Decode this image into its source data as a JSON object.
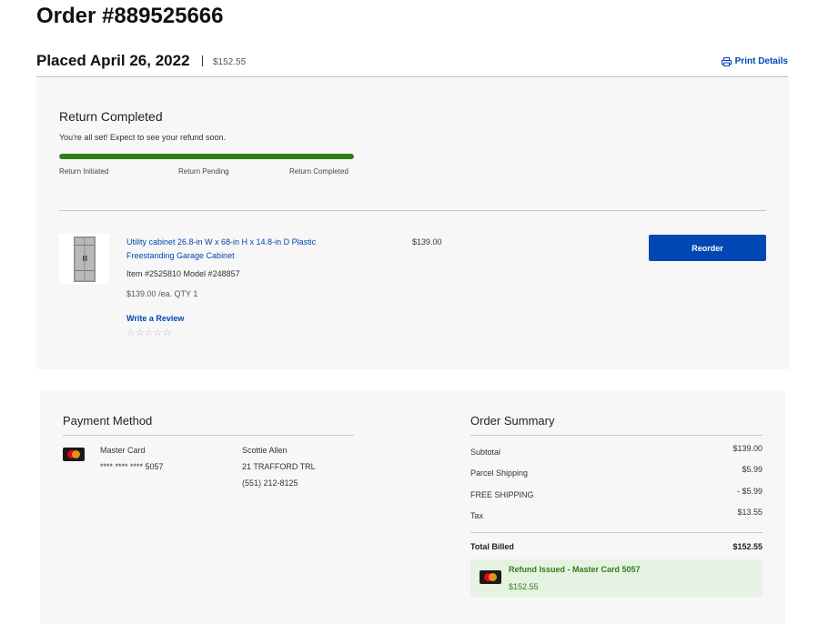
{
  "order": {
    "title": "Order #889525666",
    "placed": "Placed April 26, 2022",
    "total": "$152.55",
    "print_label": "Print Details"
  },
  "return": {
    "title": "Return Completed",
    "subtitle": "You're all set! Expect to see your refund soon.",
    "progress_fraction": 1.0,
    "progress_color": "#2e7d1a",
    "steps": [
      "Return Initiated",
      "Return Pending",
      "Return Completed"
    ]
  },
  "product": {
    "name": "Utility cabinet 26.8-in W x 68-in H x 14.8-in D Plastic Freestanding Garage Cabinet",
    "item_model": "Item #2525810 Model #248857",
    "each_qty": "$139.00 /ea. QTY 1",
    "price": "$139.00",
    "write_review": "Write a Review",
    "stars": "☆☆☆☆☆",
    "rating_out_of": 5,
    "reorder_label": "Reorder"
  },
  "payment": {
    "title": "Payment Method",
    "card_name": "Master Card",
    "card_number": "**** **** **** 5057",
    "address": [
      "Scottie Allen",
      "21 TRAFFORD TRL",
      "(551) 212-8125"
    ]
  },
  "summary": {
    "title": "Order Summary",
    "rows": [
      {
        "label": "Subtotal",
        "value": "$139.00"
      },
      {
        "label": "Parcel Shipping",
        "value": "$5.99"
      },
      {
        "label": "FREE SHIPPING",
        "value": "- $5.99"
      },
      {
        "label": "Tax",
        "value": "$13.55"
      }
    ],
    "total_label": "Total Billed",
    "total_value": "$152.55",
    "refund_title": "Refund Issued - Master Card 5057",
    "refund_amount": "$152.55"
  },
  "colors": {
    "link_blue": "#0047b3",
    "success_green": "#2e7d1a",
    "refund_bg": "#e6f2e2",
    "panel_bg": "#f7f7f7"
  }
}
